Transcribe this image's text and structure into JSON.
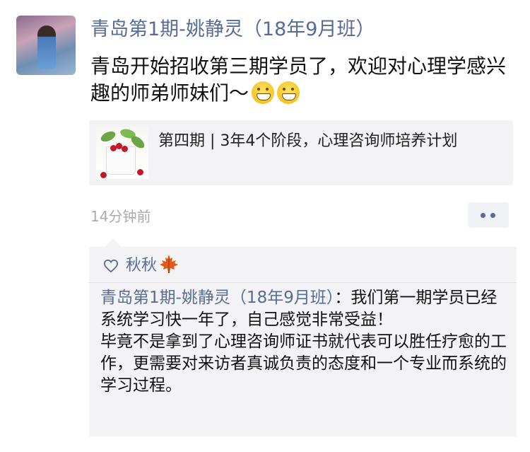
{
  "post": {
    "author_name": "青岛第1期-姚静灵（18年9月班）",
    "text": "青岛开始招收第三期学员了，欢迎对心理学感兴趣的师弟师妹们～",
    "emojis": [
      "grinning-face-emoji",
      "grinning-face-emoji"
    ],
    "timestamp": "14分钟前"
  },
  "link_card": {
    "title": "第四期 | 3年4个阶段，心理咨询师培养计划"
  },
  "likes": {
    "names": "秋秋",
    "name_decoration_icon": "maple-leaf-icon",
    "icon": "heart-outline-icon"
  },
  "comment": {
    "author": "青岛第1期-姚静灵（18年9月班）",
    "separator": "：",
    "line1": "我们第一期学员已经系统学习快一年了，自己感觉非常受益！",
    "line2": "毕竟不是拿到了心理咨询师证书就代表可以胜任疗愈的工作，更需要对来访者真诚负责的态度和一个专业而系统的学习过程。"
  },
  "colors": {
    "link_blue": "#576b95",
    "timestamp_gray": "#aaaaaa",
    "card_bg": "#f3f3f5"
  }
}
